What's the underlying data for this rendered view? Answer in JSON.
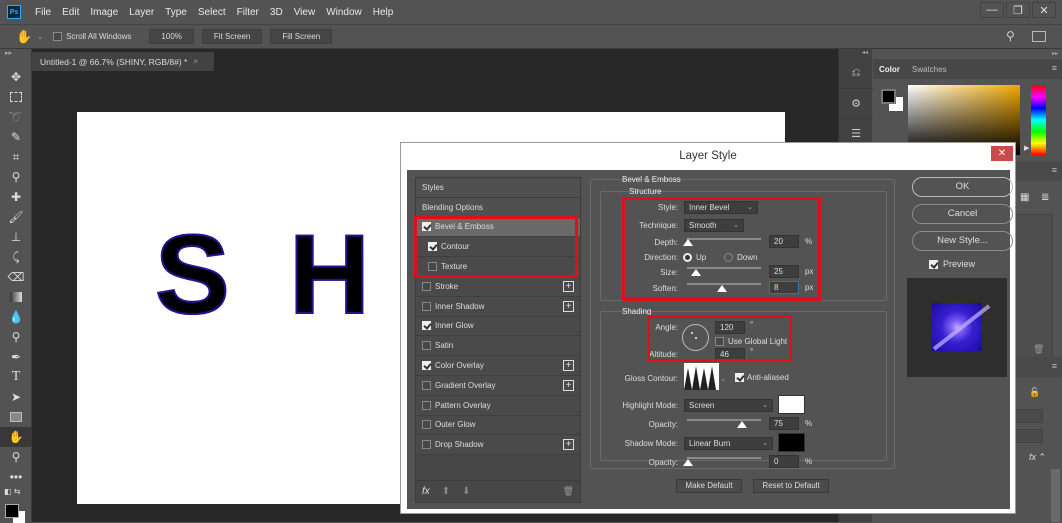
{
  "app": {
    "logo": "Ps"
  },
  "menu": [
    "File",
    "Edit",
    "Image",
    "Layer",
    "Type",
    "Select",
    "Filter",
    "3D",
    "View",
    "Window",
    "Help"
  ],
  "window_controls": {
    "minimize": "—",
    "restore": "❐",
    "close": "✕"
  },
  "options_bar": {
    "tool_icon": "hand-icon",
    "scroll_all_windows": "Scroll All Windows",
    "scroll_all_checked": false,
    "zoom_100": "100%",
    "fit_screen": "Fit Screen",
    "fill_screen": "Fill Screen"
  },
  "document": {
    "tab_title": "Untitled-1 @ 66.7% (SHINY, RGB/8#) *",
    "tab_close": "×",
    "canvas_text_visible": [
      "S",
      "H"
    ]
  },
  "tools": [
    "move",
    "marquee",
    "lasso",
    "quick-select",
    "crop",
    "eyedropper",
    "healing",
    "brush",
    "stamp",
    "history-brush",
    "eraser",
    "gradient",
    "blur",
    "dodge",
    "pen",
    "type",
    "path-select",
    "rectangle",
    "hand",
    "zoom",
    "more"
  ],
  "right_panel": {
    "color_tab": "Color",
    "swatches_tab": "Swatches",
    "foreground": "#000000",
    "background": "#ffffff"
  },
  "dialog": {
    "title": "Layer Style",
    "close": "✕",
    "styles_list": [
      {
        "label": "Styles",
        "type": "header"
      },
      {
        "label": "Blending Options",
        "type": "header"
      },
      {
        "label": "Bevel & Emboss",
        "checked": true,
        "selected": true
      },
      {
        "label": "Contour",
        "checked": true,
        "sub": true
      },
      {
        "label": "Texture",
        "checked": false,
        "sub": true
      },
      {
        "label": "Stroke",
        "checked": false,
        "plus": true
      },
      {
        "label": "Inner Shadow",
        "checked": false,
        "plus": true
      },
      {
        "label": "Inner Glow",
        "checked": true
      },
      {
        "label": "Satin",
        "checked": false
      },
      {
        "label": "Color Overlay",
        "checked": true,
        "plus": true
      },
      {
        "label": "Gradient Overlay",
        "checked": false,
        "plus": true
      },
      {
        "label": "Pattern Overlay",
        "checked": false
      },
      {
        "label": "Outer Glow",
        "checked": false
      },
      {
        "label": "Drop Shadow",
        "checked": false,
        "plus": true
      }
    ],
    "footer": {
      "fx": "fx",
      "up": "⬆",
      "down": "⬇",
      "trash": "🗑"
    },
    "bevel": {
      "section": "Bevel & Emboss",
      "structure": "Structure",
      "style_label": "Style:",
      "style_value": "Inner Bevel",
      "technique_label": "Technique:",
      "technique_value": "Smooth",
      "depth_label": "Depth:",
      "depth_value": "20",
      "depth_unit": "%",
      "direction_label": "Direction:",
      "dir_up": "Up",
      "dir_down": "Down",
      "direction_value": "Up",
      "size_label": "Size:",
      "size_value": "25",
      "size_unit": "px",
      "soften_label": "Soften:",
      "soften_value": "8",
      "soften_unit": "px"
    },
    "shading": {
      "section": "Shading",
      "angle_label": "Angle:",
      "angle_value": "120",
      "angle_unit": "°",
      "global_light": "Use Global Light",
      "global_light_checked": false,
      "altitude_label": "Altitude:",
      "altitude_value": "46",
      "altitude_unit": "°",
      "gloss_label": "Gloss Contour:",
      "anti_aliased": "Anti-aliased",
      "anti_aliased_checked": true,
      "highlight_label": "Highlight Mode:",
      "highlight_value": "Screen",
      "highlight_color": "#ffffff",
      "hl_opacity_label": "Opacity:",
      "hl_opacity_value": "75",
      "hl_opacity_unit": "%",
      "shadow_label": "Shadow Mode:",
      "shadow_value": "Linear Burn",
      "shadow_color": "#000000",
      "sh_opacity_label": "Opacity:",
      "sh_opacity_value": "0",
      "sh_opacity_unit": "%"
    },
    "make_default": "Make Default",
    "reset_default": "Reset to Default",
    "ok": "OK",
    "cancel": "Cancel",
    "new_style": "New Style...",
    "preview": "Preview",
    "preview_checked": true
  }
}
